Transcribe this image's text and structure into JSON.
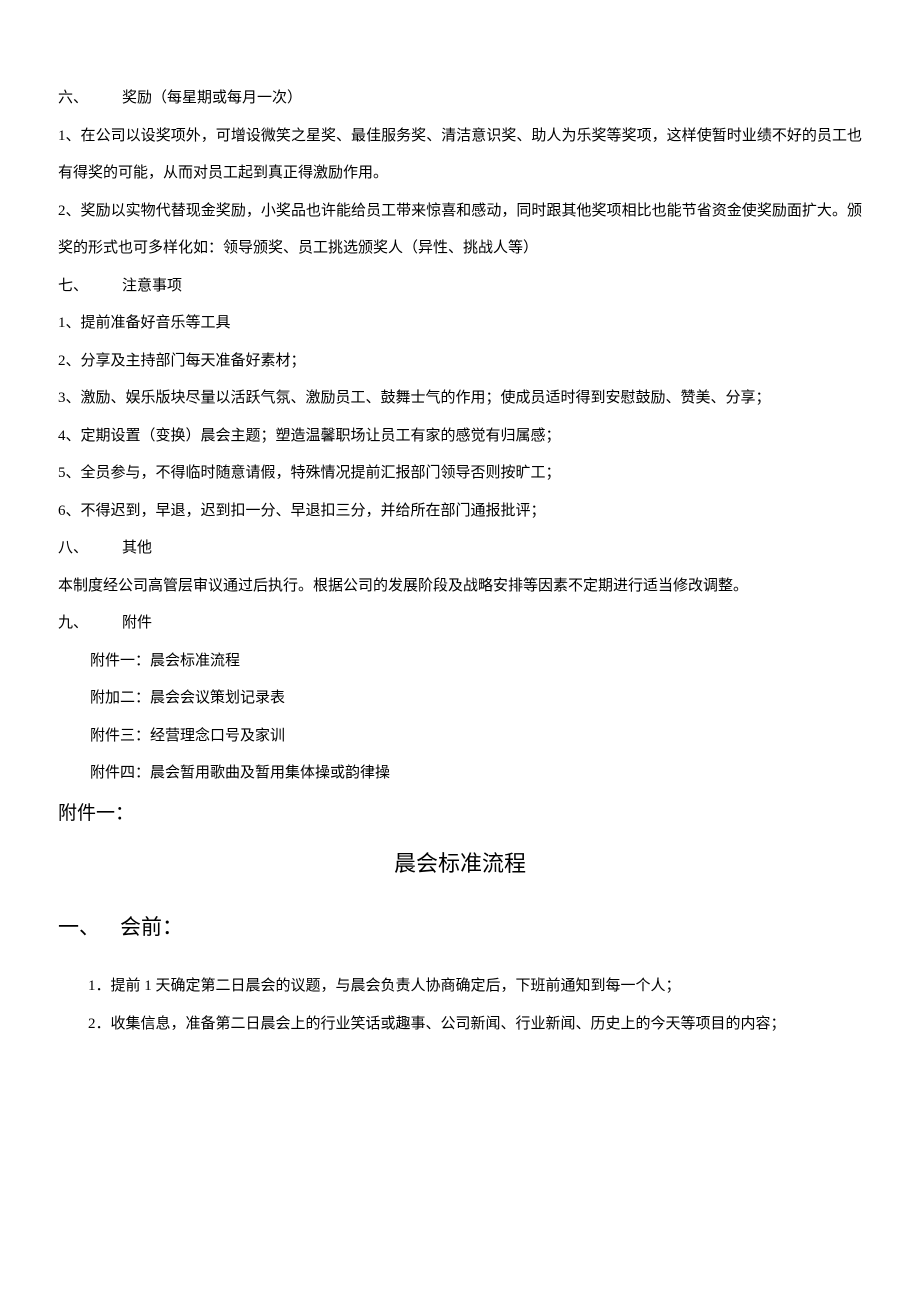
{
  "sections": {
    "six": {
      "num": "六、",
      "title": "奖励（每星期或每月一次）",
      "items": [
        "1、在公司以设奖项外，可增设微笑之星奖、最佳服务奖、清洁意识奖、助人为乐奖等奖项，这样使暂时业绩不好的员工也有得奖的可能，从而对员工起到真正得激励作用。",
        "2、奖励以实物代替现金奖励，小奖品也许能给员工带来惊喜和感动，同时跟其他奖项相比也能节省资金使奖励面扩大。颁奖的形式也可多样化如：领导颁奖、员工挑选颁奖人（异性、挑战人等）"
      ]
    },
    "seven": {
      "num": "七、",
      "title": "注意事项",
      "items": [
        "1、提前准备好音乐等工具",
        "2、分享及主持部门每天准备好素材；",
        "3、激励、娱乐版块尽量以活跃气氛、激励员工、鼓舞士气的作用；使成员适时得到安慰鼓励、赞美、分享；",
        "4、定期设置（变换）晨会主题；塑造温馨职场让员工有家的感觉有归属感；",
        "5、全员参与，不得临时随意请假，特殊情况提前汇报部门领导否则按旷工；",
        "6、不得迟到，早退，迟到扣一分、早退扣三分，并给所在部门通报批评；"
      ]
    },
    "eight": {
      "num": "八、",
      "title": "其他",
      "content": "本制度经公司高管层审议通过后执行。根据公司的发展阶段及战略安排等因素不定期进行适当修改调整。"
    },
    "nine": {
      "num": "九、",
      "title": "附件",
      "attachments": [
        "附件一：晨会标准流程",
        "附加二：晨会会议策划记录表",
        "附件三：经营理念口号及家训",
        "附件四：晨会暂用歌曲及暂用集体操或韵律操"
      ]
    }
  },
  "attachment_one": {
    "label": "附件一：",
    "title": "晨会标准流程",
    "section_one": {
      "num": "一、",
      "title": "会前：",
      "items": [
        "1．提前 1 天确定第二日晨会的议题，与晨会负责人协商确定后，下班前通知到每一个人；",
        "2．收集信息，准备第二日晨会上的行业笑话或趣事、公司新闻、行业新闻、历史上的今天等项目的内容；"
      ]
    }
  }
}
